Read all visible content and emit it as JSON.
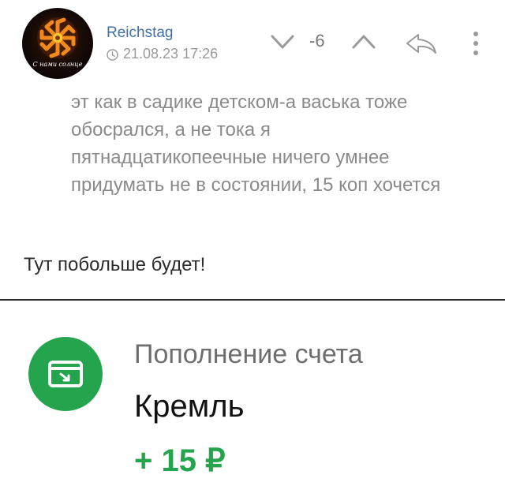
{
  "post": {
    "author": {
      "name": "Reichstag",
      "avatar_caption": "С нами солнце"
    },
    "timestamp": "21.08.23 17:26",
    "rating": "-6",
    "icons": {
      "vote_down": "chevron-down-icon",
      "vote_up": "chevron-up-icon",
      "reply": "reply-icon",
      "more": "more-vertical-icon",
      "time": "clock-icon"
    },
    "quoted_text": "эт как в садике детском-а васька тоже обосрался, а не тока я пятнадцатикопеечные ничего умнее придумать не в состоянии, 15 коп хочется",
    "comment_text": "Тут побольше будет!"
  },
  "transaction": {
    "title": "Пополнение счета",
    "merchant": "Кремль",
    "amount": "+ 15 ₽",
    "icon": "card-deposit-icon"
  },
  "colors": {
    "username": "#3f6fa8",
    "accent_green": "#24a44d",
    "muted_text": "#8a8a8a"
  }
}
